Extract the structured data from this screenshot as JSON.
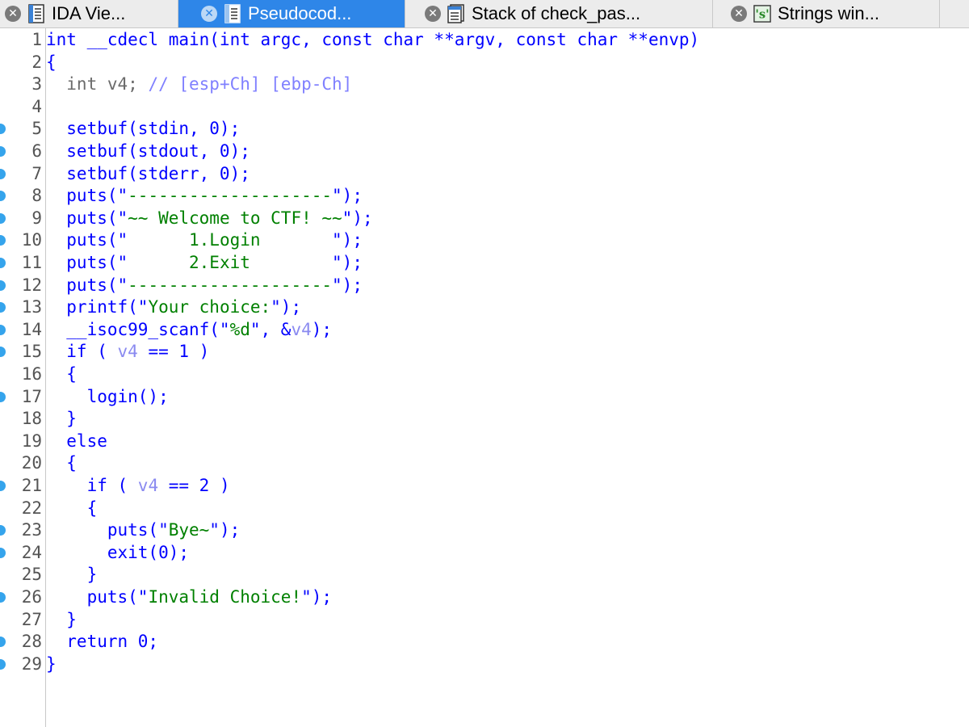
{
  "tabs": [
    {
      "label": "IDA Vie...",
      "icon": "text-view-icon",
      "active": false
    },
    {
      "label": "Pseudocod...",
      "icon": "text-view-icon",
      "active": true
    },
    {
      "label": "Stack of check_pas...",
      "icon": "stack-icon",
      "active": false
    },
    {
      "label": "Strings win...",
      "icon": "strings-icon",
      "active": false
    }
  ],
  "colors": {
    "active_tab": "#2e86e8",
    "keyword": "#0000ff",
    "string": "#008000",
    "variable": "#8a8af0",
    "comment": "#8080ff",
    "breakpoint_dot": "#35a4ec"
  },
  "code": {
    "lines": [
      {
        "num": "1",
        "dot": false,
        "parts": [
          {
            "t": "int __cdecl main(int argc, const char **argv, const char **envp)",
            "c": "kw"
          }
        ]
      },
      {
        "num": "2",
        "dot": false,
        "parts": [
          {
            "t": "{",
            "c": "kw"
          }
        ]
      },
      {
        "num": "3",
        "dot": false,
        "parts": [
          {
            "t": "  int v4; ",
            "c": "gray"
          },
          {
            "t": "// [esp+Ch] [ebp-Ch]",
            "c": "cmt"
          }
        ]
      },
      {
        "num": "4",
        "dot": false,
        "parts": []
      },
      {
        "num": "5",
        "dot": true,
        "parts": [
          {
            "t": "  setbuf(stdin, 0);",
            "c": "kw"
          }
        ]
      },
      {
        "num": "6",
        "dot": true,
        "parts": [
          {
            "t": "  setbuf(stdout, 0);",
            "c": "kw"
          }
        ]
      },
      {
        "num": "7",
        "dot": true,
        "parts": [
          {
            "t": "  setbuf(stderr, 0);",
            "c": "kw"
          }
        ]
      },
      {
        "num": "8",
        "dot": true,
        "parts": [
          {
            "t": "  puts(\"",
            "c": "kw"
          },
          {
            "t": "--------------------",
            "c": "str"
          },
          {
            "t": "\");",
            "c": "kw"
          }
        ]
      },
      {
        "num": "9",
        "dot": true,
        "parts": [
          {
            "t": "  puts(\"",
            "c": "kw"
          },
          {
            "t": "~~ Welcome to CTF! ~~",
            "c": "str"
          },
          {
            "t": "\");",
            "c": "kw"
          }
        ]
      },
      {
        "num": "10",
        "dot": true,
        "parts": [
          {
            "t": "  puts(\"",
            "c": "kw"
          },
          {
            "t": "      1.Login       ",
            "c": "str"
          },
          {
            "t": "\");",
            "c": "kw"
          }
        ]
      },
      {
        "num": "11",
        "dot": true,
        "parts": [
          {
            "t": "  puts(\"",
            "c": "kw"
          },
          {
            "t": "      2.Exit        ",
            "c": "str"
          },
          {
            "t": "\");",
            "c": "kw"
          }
        ]
      },
      {
        "num": "12",
        "dot": true,
        "parts": [
          {
            "t": "  puts(\"",
            "c": "kw"
          },
          {
            "t": "--------------------",
            "c": "str"
          },
          {
            "t": "\");",
            "c": "kw"
          }
        ]
      },
      {
        "num": "13",
        "dot": true,
        "parts": [
          {
            "t": "  printf(\"",
            "c": "kw"
          },
          {
            "t": "Your choice:",
            "c": "str"
          },
          {
            "t": "\");",
            "c": "kw"
          }
        ]
      },
      {
        "num": "14",
        "dot": true,
        "parts": [
          {
            "t": "  __isoc99_scanf(\"",
            "c": "kw"
          },
          {
            "t": "%d",
            "c": "str"
          },
          {
            "t": "\", &",
            "c": "kw"
          },
          {
            "t": "v4",
            "c": "var"
          },
          {
            "t": ");",
            "c": "kw"
          }
        ]
      },
      {
        "num": "15",
        "dot": true,
        "parts": [
          {
            "t": "  if ( ",
            "c": "kw"
          },
          {
            "t": "v4",
            "c": "var"
          },
          {
            "t": " == 1 )",
            "c": "kw"
          }
        ]
      },
      {
        "num": "16",
        "dot": false,
        "parts": [
          {
            "t": "  {",
            "c": "kw"
          }
        ]
      },
      {
        "num": "17",
        "dot": true,
        "parts": [
          {
            "t": "    login();",
            "c": "kw"
          }
        ]
      },
      {
        "num": "18",
        "dot": false,
        "parts": [
          {
            "t": "  }",
            "c": "kw"
          }
        ]
      },
      {
        "num": "19",
        "dot": false,
        "parts": [
          {
            "t": "  else",
            "c": "kw"
          }
        ]
      },
      {
        "num": "20",
        "dot": false,
        "parts": [
          {
            "t": "  {",
            "c": "kw"
          }
        ]
      },
      {
        "num": "21",
        "dot": true,
        "parts": [
          {
            "t": "    if ( ",
            "c": "kw"
          },
          {
            "t": "v4",
            "c": "var"
          },
          {
            "t": " == 2 )",
            "c": "kw"
          }
        ]
      },
      {
        "num": "22",
        "dot": false,
        "parts": [
          {
            "t": "    {",
            "c": "kw"
          }
        ]
      },
      {
        "num": "23",
        "dot": true,
        "parts": [
          {
            "t": "      puts(\"",
            "c": "kw"
          },
          {
            "t": "Bye~",
            "c": "str"
          },
          {
            "t": "\");",
            "c": "kw"
          }
        ]
      },
      {
        "num": "24",
        "dot": true,
        "parts": [
          {
            "t": "      exit(0);",
            "c": "kw"
          }
        ]
      },
      {
        "num": "25",
        "dot": false,
        "parts": [
          {
            "t": "    }",
            "c": "kw"
          }
        ]
      },
      {
        "num": "26",
        "dot": true,
        "parts": [
          {
            "t": "    puts(\"",
            "c": "kw"
          },
          {
            "t": "Invalid Choice!",
            "c": "str"
          },
          {
            "t": "\");",
            "c": "kw"
          }
        ]
      },
      {
        "num": "27",
        "dot": false,
        "parts": [
          {
            "t": "  }",
            "c": "kw"
          }
        ]
      },
      {
        "num": "28",
        "dot": true,
        "parts": [
          {
            "t": "  return 0;",
            "c": "kw"
          }
        ]
      },
      {
        "num": "29",
        "dot": true,
        "parts": [
          {
            "t": "}",
            "c": "kw"
          }
        ]
      }
    ]
  }
}
